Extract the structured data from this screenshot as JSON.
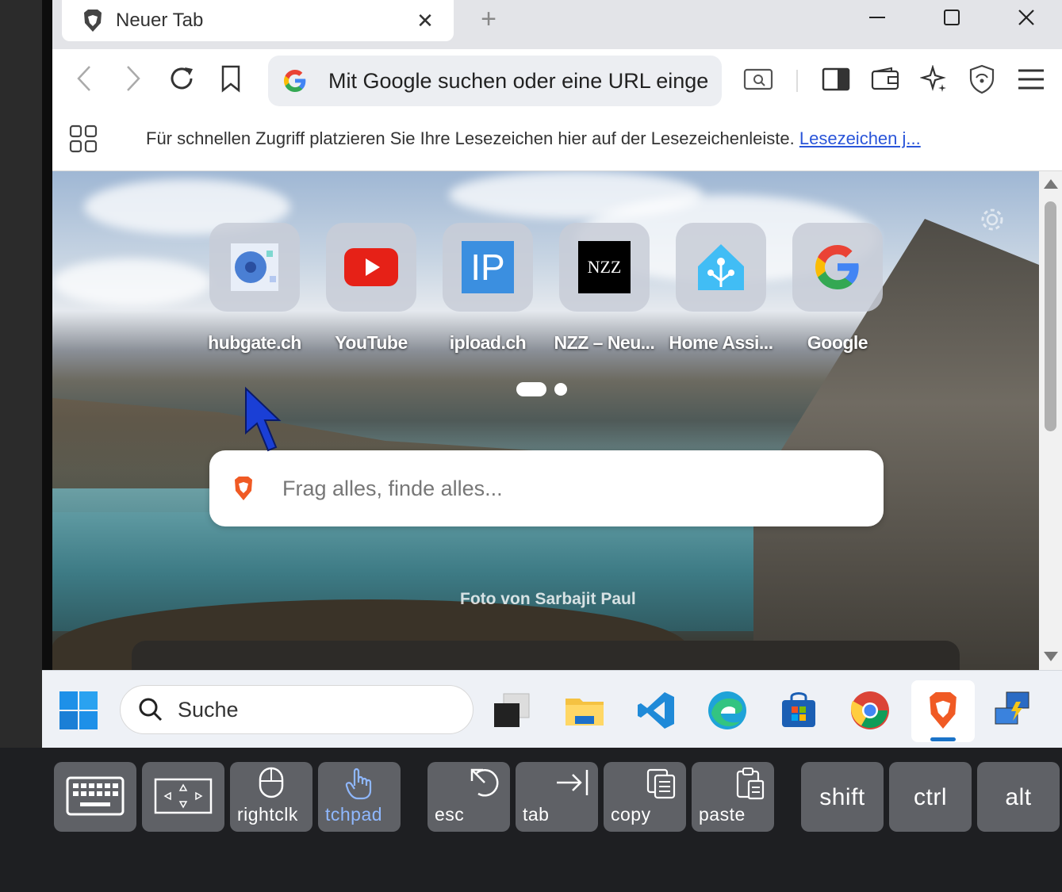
{
  "browser": {
    "tab_title": "Neuer Tab",
    "tab_close": "✕",
    "new_tab": "+",
    "omnibox_text": "Mit Google suchen oder eine URL einge",
    "bookmark_hint": "Für schnellen Zugriff platzieren Sie Ihre Lesezeichen hier auf der Lesezeichenleiste.",
    "bookmark_link": "Lesezeichen j..."
  },
  "ntp": {
    "tiles": [
      {
        "label": "hubgate.ch",
        "icon": "hubgate-icon"
      },
      {
        "label": "YouTube",
        "icon": "youtube-icon"
      },
      {
        "label": "ipload.ch",
        "icon": "ipload-icon",
        "text": "IP"
      },
      {
        "label": "NZZ – Neu...",
        "icon": "nzz-icon",
        "text": "NZZ"
      },
      {
        "label": "Home Assi...",
        "icon": "home-assistant-icon"
      },
      {
        "label": "Google",
        "icon": "google-icon"
      }
    ],
    "search_placeholder": "Frag alles, finde alles...",
    "photo_credit": "Foto von Sarbajit Paul"
  },
  "taskbar": {
    "search_label": "Suche",
    "apps": [
      "task-view-icon",
      "file-explorer-icon",
      "vscode-icon",
      "edge-icon",
      "store-icon",
      "chrome-icon",
      "brave-icon",
      "remote-desktop-icon"
    ]
  },
  "keys": {
    "rightclk": "rightclk",
    "tchpad": "tchpad",
    "esc": "esc",
    "tab": "tab",
    "copy": "copy",
    "paste": "paste",
    "shift": "shift",
    "ctrl": "ctrl",
    "alt": "alt"
  },
  "colors": {
    "link": "#2a55d9",
    "tchpad_active": "#8fb8ff",
    "key_bg": "#5f6166"
  }
}
